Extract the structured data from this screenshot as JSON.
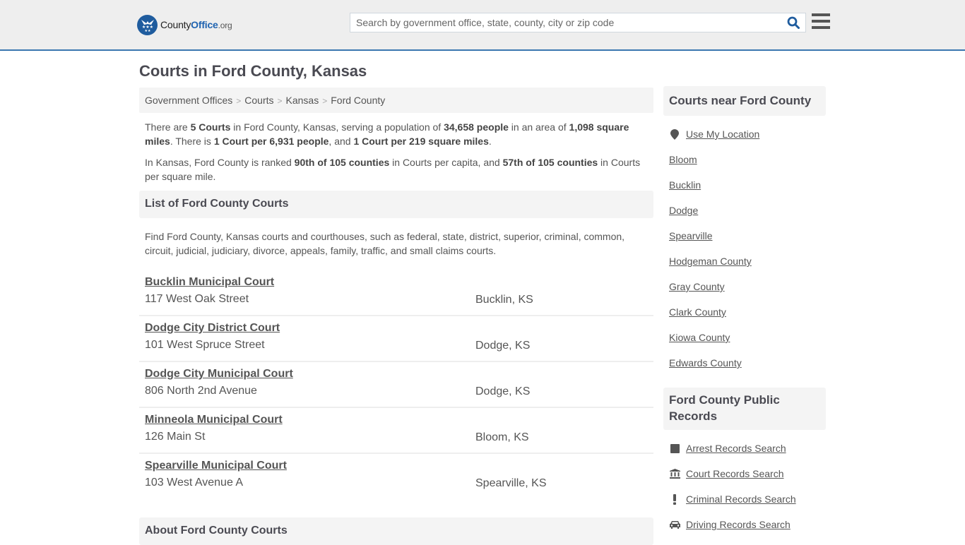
{
  "header": {
    "logo": {
      "prefix": "County",
      "brand": "Office",
      "suffix": ".org"
    },
    "search": {
      "placeholder": "Search by government office, state, county, city or zip code",
      "value": ""
    },
    "colors": {
      "accent": "#3a77b0",
      "logo_blue": "#1f5c9e",
      "search_icon": "#1f5c9e"
    }
  },
  "page": {
    "title": "Courts in Ford County, Kansas"
  },
  "breadcrumb": [
    {
      "label": "Government Offices"
    },
    {
      "label": "Courts"
    },
    {
      "label": "Kansas"
    },
    {
      "label": "Ford County"
    }
  ],
  "breadcrumb_separator": ">",
  "intro": {
    "p1": {
      "t1": "There are ",
      "b1": "5 Courts",
      "t2": " in Ford County, Kansas, serving a population of ",
      "b2": "34,658 people",
      "t3": " in an area of ",
      "b3": "1,098 square miles",
      "t4": ". There is ",
      "b4": "1 Court per 6,931 people",
      "t5": ", and ",
      "b5": "1 Court per 219 square miles",
      "t6": "."
    },
    "p2": {
      "t1": "In Kansas, Ford County is ranked ",
      "b1": "90th of 105 counties",
      "t2": " in Courts per capita, and ",
      "b2": "57th of 105 counties",
      "t3": " in Courts per square mile."
    }
  },
  "list": {
    "heading": "List of Ford County Courts",
    "description": "Find Ford County, Kansas courts and courthouses, such as federal, state, district, superior, criminal, common, circuit, judicial, judiciary, divorce, appeals, family, traffic, and small claims courts.",
    "courts": [
      {
        "name": "Bucklin Municipal Court",
        "address": "117 West Oak Street",
        "city": "Bucklin, KS"
      },
      {
        "name": "Dodge City District Court",
        "address": "101 West Spruce Street",
        "city": "Dodge, KS"
      },
      {
        "name": "Dodge City Municipal Court",
        "address": "806 North 2nd Avenue",
        "city": "Dodge, KS"
      },
      {
        "name": "Minneola Municipal Court",
        "address": "126 Main St",
        "city": "Bloom, KS"
      },
      {
        "name": "Spearville Municipal Court",
        "address": "103 West Avenue A",
        "city": "Spearville, KS"
      }
    ]
  },
  "about": {
    "heading": "About Ford County Courts"
  },
  "sidebar": {
    "nearby": {
      "heading": "Courts near Ford County",
      "location_link": {
        "label": "Use My Location",
        "icon": "map-marker-icon"
      },
      "links": [
        "Bloom",
        "Bucklin",
        "Dodge",
        "Spearville",
        "Hodgeman County",
        "Gray County",
        "Clark County",
        "Kiowa County",
        "Edwards County"
      ]
    },
    "records": {
      "heading": "Ford County Public Records",
      "links": [
        {
          "label": "Arrest Records Search",
          "icon": "square-icon"
        },
        {
          "label": "Court Records Search",
          "icon": "courthouse-icon"
        },
        {
          "label": "Criminal Records Search",
          "icon": "exclamation-icon"
        },
        {
          "label": "Driving Records Search",
          "icon": "car-icon"
        }
      ]
    }
  }
}
